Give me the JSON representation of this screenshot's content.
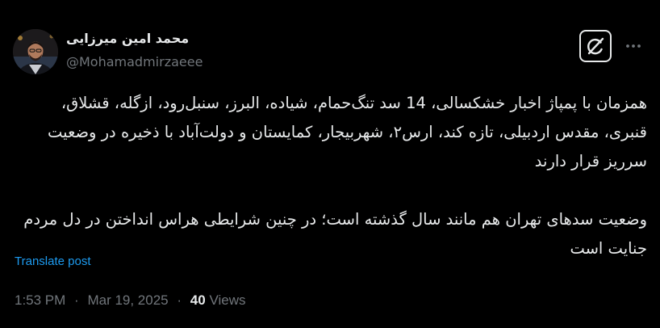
{
  "author": {
    "display_name": "محمد امین میرزایی",
    "handle": "@Mohamadmirzaeee"
  },
  "icons": {
    "avatar": "profile-photo",
    "grok": "grok-slash-icon",
    "more": "more-dots-icon"
  },
  "post": {
    "text": "همزمان با پمپاژ اخبار خشکسالی، 14 سد تنگ‌حمام، شیاده، البرز، سنبل‌رود، ازگله، قشلاق، قنبری، مقدس اردبیلی، تازه کند، ارس۲، شهربیجار، کمایستان و دولت‌آباد با ذخیره در وضعیت سرریز قرار دارند\n\nوضعیت سدهای تهران هم مانند سال گذشته است؛ در چنین شرایطی هراس انداختن در دل مردم جنایت است",
    "translate_label": "Translate post"
  },
  "meta": {
    "time": "1:53 PM",
    "separator": "·",
    "date": "Mar 19, 2025",
    "views_count": "40",
    "views_label": "Views"
  },
  "colors": {
    "background": "#000000",
    "text_primary": "#e7e9ea",
    "text_secondary": "#71767b",
    "link": "#1d9bf0"
  }
}
